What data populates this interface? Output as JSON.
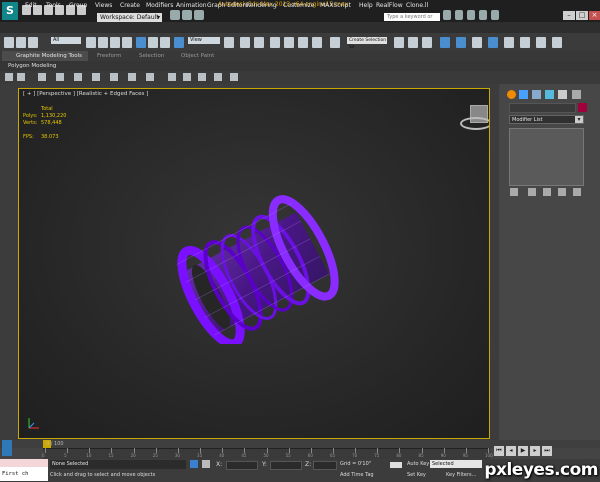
{
  "titlebar": {
    "logo": "S",
    "workspace": "Workspace: Default",
    "window_title": "Autodesk 3ds Max 2013 x64      engine15.max",
    "search_placeholder": "Type a keyword or phrase"
  },
  "menu": [
    "Edit",
    "Tools",
    "Group",
    "Views",
    "Create",
    "Modifiers",
    "Animation",
    "Graph Editors",
    "Rendering",
    "Customize",
    "MAXScript",
    "Help",
    "RealFlow",
    "Clone.ll"
  ],
  "toolbar": {
    "selection_filter": "All",
    "reference_coord": "View",
    "named_selection": "Create Selection Se"
  },
  "ribbon": {
    "tabs": [
      "Graphite Modeling Tools",
      "Freeform",
      "Selection",
      "Object Paint"
    ],
    "panel": "Polygon Modeling"
  },
  "viewport": {
    "label": "[ + ] [Perspective ] [Realistic + Edged Faces ]",
    "stats": {
      "total_label": "Total",
      "polys_label": "Polys:",
      "polys_value": "1,130,220",
      "verts_label": "Verts:",
      "verts_value": "578,448",
      "fps_label": "FPS:",
      "fps_value": "38.073"
    },
    "model_color": "#6a00d0"
  },
  "command_panel": {
    "modifier_list": "Modifier List",
    "color_swatch": "#a0003c"
  },
  "timeline": {
    "frame": "0 / 100",
    "ticks": [
      "0",
      "5",
      "10",
      "15",
      "20",
      "25",
      "30",
      "35",
      "40",
      "45",
      "50",
      "55",
      "60",
      "65",
      "70",
      "75",
      "80",
      "85",
      "90",
      "95",
      "100"
    ]
  },
  "status": {
    "maxscript": "First ch",
    "selection": "None Selected",
    "prompt": "Click and drag to select and move objects",
    "x_label": "X:",
    "y_label": "Y:",
    "z_label": "Z:",
    "grid": "Grid = 0'10\"",
    "add_time_tag": "Add Time Tag",
    "auto_key": "Auto Key",
    "set_key": "Set Key",
    "key_mode": "Selected",
    "key_filters": "Key Filters..."
  },
  "watermark": "pxleyes.com"
}
